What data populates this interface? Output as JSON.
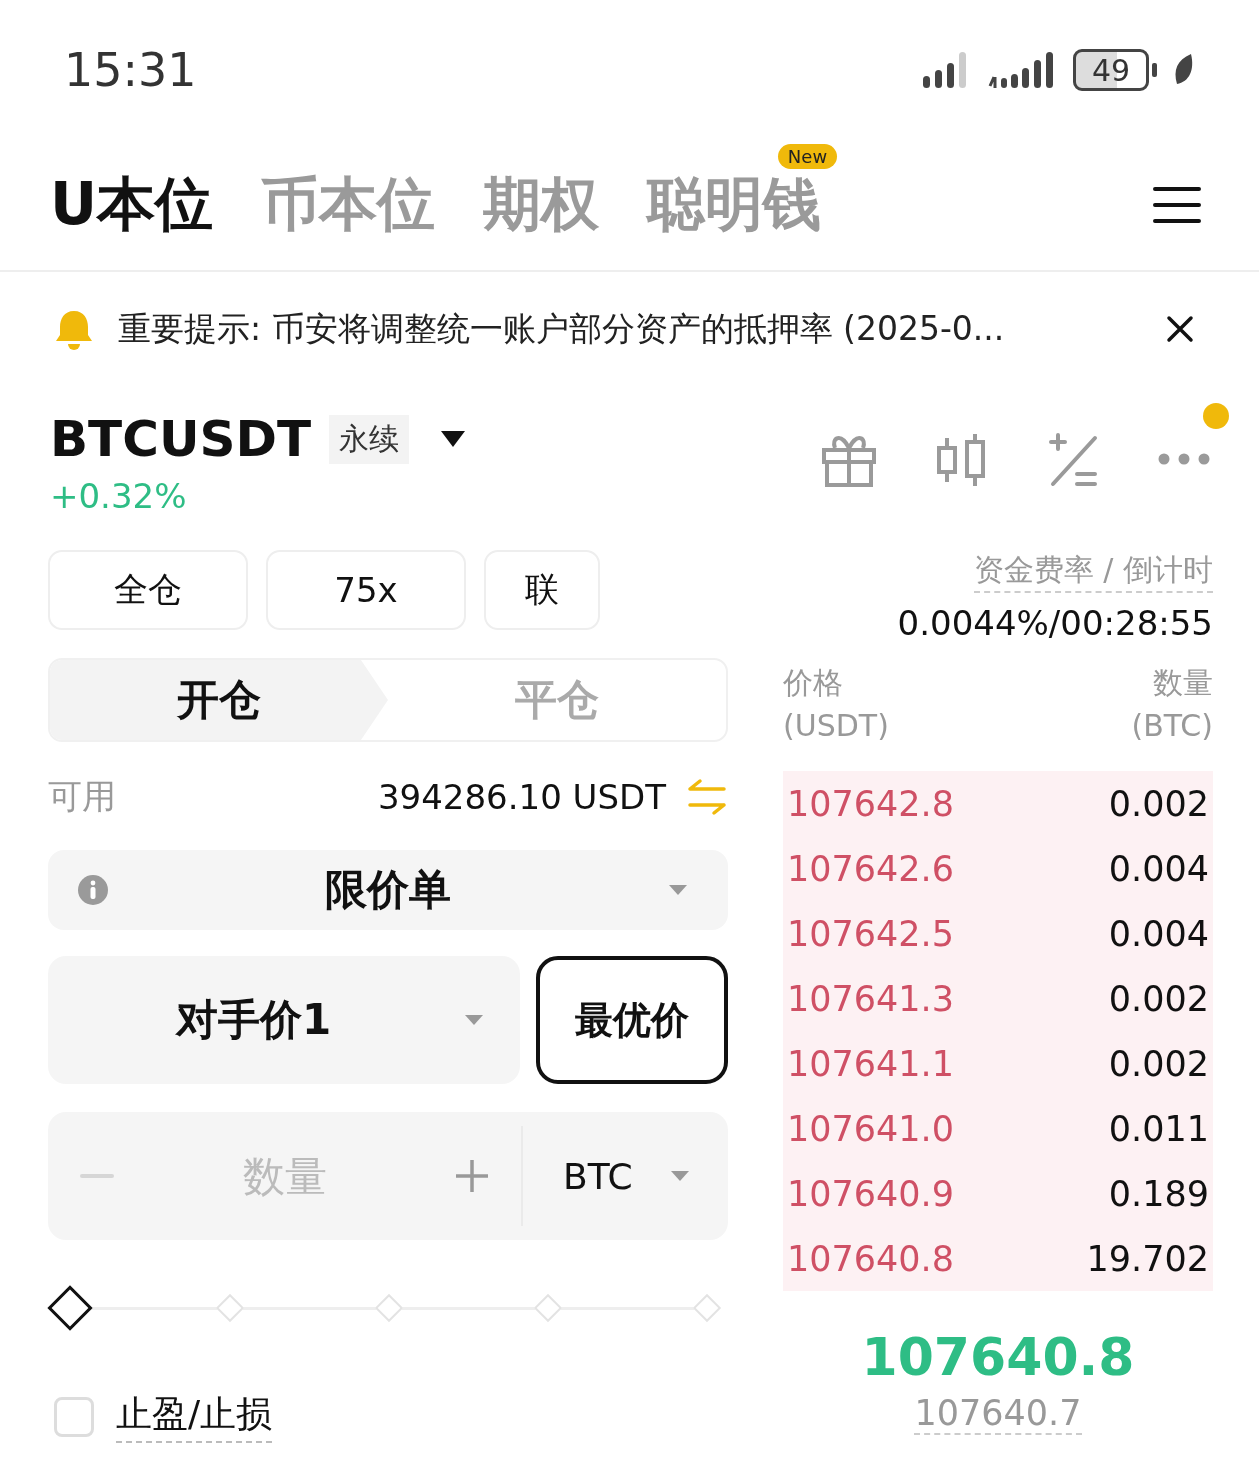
{
  "status_bar": {
    "time": "15:31",
    "battery": "49"
  },
  "tabs": [
    {
      "label": "U本位",
      "selected": true
    },
    {
      "label": "币本位",
      "selected": false
    },
    {
      "label": "期权",
      "selected": false
    },
    {
      "label": "聪明钱",
      "selected": false,
      "badge": "New"
    }
  ],
  "notice": {
    "text": "重要提示: 币安将调整统一账户部分资产的抵押率 (2025-0..."
  },
  "symbol": {
    "name": "BTCUSDT",
    "tag": "永续",
    "change": "+0.32%",
    "alert_dot": true
  },
  "margin_buttons": [
    "全仓",
    "75x",
    "联"
  ],
  "side_tabs": [
    {
      "label": "开仓",
      "selected": true
    },
    {
      "label": "平仓",
      "selected": false
    }
  ],
  "available": {
    "label": "可用",
    "value": "394286.10 USDT"
  },
  "order_type": {
    "value": "限价单"
  },
  "price": {
    "value": "对手价1",
    "button": "最优价"
  },
  "quantity": {
    "placeholder": "数量",
    "unit": "BTC"
  },
  "slider": {
    "level": 0
  },
  "tp_sl": {
    "label": "止盈/止损",
    "checked": false
  },
  "funding": {
    "label": "资金费率 / 倒计时",
    "value": "0.0044%/00:28:55"
  },
  "orderbook": {
    "columns": [
      {
        "title": "价格",
        "unit": "(USDT)"
      },
      {
        "title": "数量",
        "unit": "(BTC)"
      }
    ],
    "asks": [
      {
        "price": "107642.8",
        "qty": "0.002"
      },
      {
        "price": "107642.6",
        "qty": "0.004"
      },
      {
        "price": "107642.5",
        "qty": "0.004"
      },
      {
        "price": "107641.3",
        "qty": "0.002"
      },
      {
        "price": "107641.1",
        "qty": "0.002"
      },
      {
        "price": "107641.0",
        "qty": "0.011"
      },
      {
        "price": "107640.9",
        "qty": "0.189"
      },
      {
        "price": "107640.8",
        "qty": "19.702"
      }
    ],
    "last_price": "107640.8",
    "mark_price": "107640.7"
  }
}
